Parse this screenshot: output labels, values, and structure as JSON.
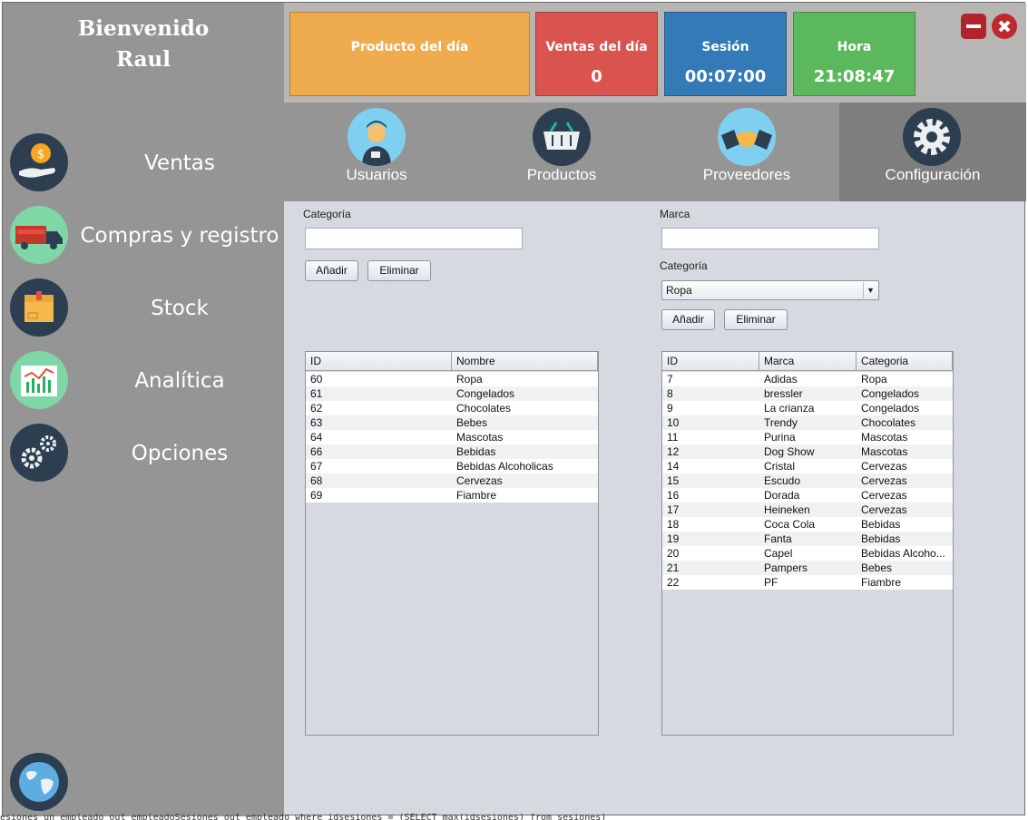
{
  "welcome": {
    "greeting": "Bienvenido",
    "user": "Raul"
  },
  "sidebar": {
    "items": [
      {
        "label": "Ventas",
        "icon": "money-hand-icon"
      },
      {
        "label": "Compras y registro",
        "icon": "delivery-truck-icon"
      },
      {
        "label": "Stock",
        "icon": "package-box-icon"
      },
      {
        "label": "Analítica",
        "icon": "chart-icon"
      },
      {
        "label": "Opciones",
        "icon": "gears-icon"
      }
    ],
    "bottom_icon": "globe-icon"
  },
  "cards": {
    "product": {
      "title": "Producto del día",
      "value": "",
      "color": "#efac4e"
    },
    "sales": {
      "title": "Ventas del día",
      "value": "0",
      "color": "#d9534f"
    },
    "session": {
      "title": "Sesión",
      "value": "00:07:00",
      "color": "#337ab7"
    },
    "time": {
      "title": "Hora",
      "value": "21:08:47",
      "color": "#5cb85c"
    }
  },
  "window_controls": {
    "minimize_icon": "minimize-icon",
    "close_icon": "close-icon"
  },
  "tabs": [
    {
      "label": "Usuarios",
      "icon": "user-icon",
      "active": false
    },
    {
      "label": "Productos",
      "icon": "basket-icon",
      "active": false
    },
    {
      "label": "Proveedores",
      "icon": "handshake-icon",
      "active": false
    },
    {
      "label": "Configuración",
      "icon": "gear-icon",
      "active": true
    }
  ],
  "category_panel": {
    "label": "Categoría",
    "input_value": "",
    "add_label": "Añadir",
    "delete_label": "Eliminar",
    "table": {
      "columns": [
        "ID",
        "Nombre"
      ],
      "rows": [
        [
          "60",
          "Ropa"
        ],
        [
          "61",
          "Congelados"
        ],
        [
          "62",
          "Chocolates"
        ],
        [
          "63",
          "Bebes"
        ],
        [
          "64",
          "Mascotas"
        ],
        [
          "66",
          "Bebidas"
        ],
        [
          "67",
          "Bebidas Alcoholicas"
        ],
        [
          "68",
          "Cervezas"
        ],
        [
          "69",
          "Fiambre"
        ]
      ]
    }
  },
  "brand_panel": {
    "label": "Marca",
    "input_value": "",
    "category_label": "Categoría",
    "category_selected": "Ropa",
    "add_label": "Añadir",
    "delete_label": "Eliminar",
    "table": {
      "columns": [
        "ID",
        "Marca",
        "Categoria"
      ],
      "rows": [
        [
          "7",
          "Adidas",
          "Ropa"
        ],
        [
          "8",
          "bressler",
          "Congelados"
        ],
        [
          "9",
          "La crianza",
          "Congelados"
        ],
        [
          "10",
          "Trendy",
          "Chocolates"
        ],
        [
          "11",
          "Purina",
          "Mascotas"
        ],
        [
          "12",
          "Dog Show",
          "Mascotas"
        ],
        [
          "14",
          "Cristal",
          "Cervezas"
        ],
        [
          "15",
          "Escudo",
          "Cervezas"
        ],
        [
          "16",
          "Dorada",
          "Cervezas"
        ],
        [
          "17",
          "Heineken",
          "Cervezas"
        ],
        [
          "18",
          "Coca Cola",
          "Bebidas"
        ],
        [
          "19",
          "Fanta",
          "Bebidas"
        ],
        [
          "20",
          "Capel",
          "Bebidas Alcoho..."
        ],
        [
          "21",
          "Pampers",
          "Bebes"
        ],
        [
          "22",
          "PF",
          "Fiambre"
        ]
      ]
    }
  },
  "footer_text": "esiones un empleado out empleadoSesiones out empleado where idsesiones = (SELECT max(idsesiones) from sesiones)"
}
